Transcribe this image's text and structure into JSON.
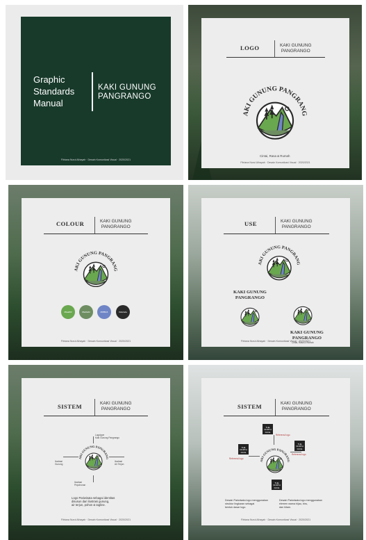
{
  "cover": {
    "title": "Graphic\nStandards\nManual",
    "brand": "KAKI GUNUNG\nPANGRANGO",
    "footer": "Fitriana Nurul Alhayah · Desain Komunikasi Visual · 2020/2021"
  },
  "logo_page": {
    "heading": "LOGO",
    "brand": "KAKI GUNUNG\nPANGRANGO",
    "emblem_arc": "KAKI GUNUNG PANGRANGO",
    "tagline": "Cintai, Rasa & Rumah",
    "footer": "Fitriana Nurul Alhayah · Desain Komunikasi Visual · 2020/2021"
  },
  "colour_page": {
    "heading": "COLOUR",
    "brand": "KAKI GUNUNG\nPANGRANGO",
    "emblem_arc": "KAKI GUNUNG PANGRANGO",
    "swatches": [
      {
        "label": "#6aa84f",
        "color": "#6aa84f"
      },
      {
        "label": "#6e8e62",
        "color": "#6e8e62"
      },
      {
        "label": "#6f85c6",
        "color": "#6f85c6"
      },
      {
        "label": "#2a2a2a",
        "color": "#2a2a2a"
      }
    ],
    "footer": "Fitriana Nurul Alhayah · Desain Komunikasi Visual · 2020/2021"
  },
  "use_page": {
    "heading": "USE",
    "brand": "KAKI GUNUNG\nPANGRANGO",
    "emblem_arc": "KAKI GUNUNG PANGRANGO",
    "alt_left": "KAKI GUNUNG\nPANGRANGO",
    "alt_right": "KAKI GUNUNG\nPANGRANGO",
    "alt_tagline": "Cintai, Rasa & Rumah",
    "footer": "Fitriana Nurul Alhayah · Desain Komunikasi Visual · 2020/2021"
  },
  "system_page_1": {
    "heading": "SISTEM",
    "brand": "KAKI GUNUNG\nPANGRANGO",
    "emblem_arc": "KAKI GUNUNG PANGRANGO",
    "notes": [
      "Logotype\nKaki Gunung Pangrango",
      "Ilustrasi\nGunung",
      "Ilustrasi\nAir Terjun",
      "Ilustrasi\nPepohonan"
    ],
    "description": "Logo Pariwisata sebagai identitas\ndisusun dari ilustrasi gunung,\nair terjun, pohon & tagline.",
    "footer": "Fitriana Nurul Alhayah · Desain Komunikasi Visual · 2020/2021"
  },
  "system_page_2": {
    "heading": "SISTEM",
    "brand": "KAKI GUNUNG\nPANGRANGO",
    "emblem_arc": "KAKI GUNUNG PANGRANGO",
    "badge_text": "THE\nNORTH\nFACE",
    "notes": [
      "Referensi logo",
      "Referensi logo",
      "Referensi logo"
    ],
    "description_left": "Desain Pariwisata logo menggunakan\nstruktur lingkaran sebagai\nbentuk dasar logo.",
    "description_right": "Desain Pariwisata logo menggunakan\nelemen warna hijau, biru,\ndan hitam.",
    "footer": "Fitriana Nurul Alhayah · Desain Komunikasi Visual · 2020/2021"
  },
  "colors": {
    "green": "#6aa84f",
    "blue": "#6f85c6",
    "dark_green": "#183a2b",
    "ink": "#2a2a2a"
  }
}
